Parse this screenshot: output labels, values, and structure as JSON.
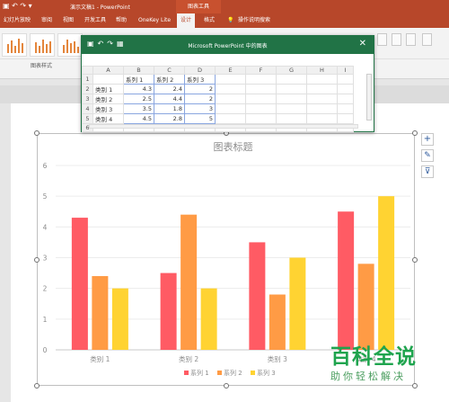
{
  "titlebar": {
    "qat": "▣ ↶ ↷ ▾",
    "doc_title": "演示文稿1 - PowerPoint",
    "context_tools": "图表工具"
  },
  "tabs": [
    {
      "label": "幻灯片放映"
    },
    {
      "label": "审阅"
    },
    {
      "label": "视图"
    },
    {
      "label": "开发工具"
    },
    {
      "label": "帮助"
    },
    {
      "label": "OneKey Lite"
    },
    {
      "label": "设计"
    },
    {
      "label": "格式"
    },
    {
      "label": "操作说明搜索"
    }
  ],
  "ribbon": {
    "group_label": "图表样式"
  },
  "excel": {
    "title": "Microsoft PowerPoint 中的图表",
    "col_headers": [
      "",
      "A",
      "B",
      "C",
      "D",
      "E",
      "F",
      "G",
      "H",
      "I"
    ],
    "rows": [
      [
        "1",
        "",
        "系列 1",
        "系列 2",
        "系列 3",
        "",
        "",
        "",
        "",
        ""
      ],
      [
        "2",
        "类别 1",
        "4.3",
        "2.4",
        "2",
        "",
        "",
        "",
        "",
        ""
      ],
      [
        "3",
        "类别 2",
        "2.5",
        "4.4",
        "2",
        "",
        "",
        "",
        "",
        ""
      ],
      [
        "4",
        "类别 3",
        "3.5",
        "1.8",
        "3",
        "",
        "",
        "",
        "",
        ""
      ],
      [
        "5",
        "类别 4",
        "4.5",
        "2.8",
        "5",
        "",
        "",
        "",
        "",
        ""
      ],
      [
        "6",
        "",
        "",
        "",
        "",
        "",
        "",
        "",
        "",
        ""
      ]
    ]
  },
  "side_buttons": {
    "add": "+",
    "style": "✎",
    "filter": "⊽"
  },
  "chart_data": {
    "type": "bar",
    "title": "图表标题",
    "categories": [
      "类别 1",
      "类别 2",
      "类别 3",
      "类别 4"
    ],
    "series": [
      {
        "name": "系列 1",
        "values": [
          4.3,
          2.5,
          3.5,
          4.5
        ],
        "color": "#ff5b64"
      },
      {
        "name": "系列 2",
        "values": [
          2.4,
          4.4,
          1.8,
          2.8
        ],
        "color": "#ff9b45"
      },
      {
        "name": "系列 3",
        "values": [
          2,
          2,
          3,
          5
        ],
        "color": "#ffd332"
      }
    ],
    "ylim": [
      0,
      6
    ],
    "yticks": [
      "0",
      "1",
      "2",
      "3",
      "4",
      "5",
      "6"
    ],
    "grid": true,
    "legend": "bottom"
  },
  "watermark": {
    "main": "百科全说",
    "sub": "助你轻松解决"
  }
}
